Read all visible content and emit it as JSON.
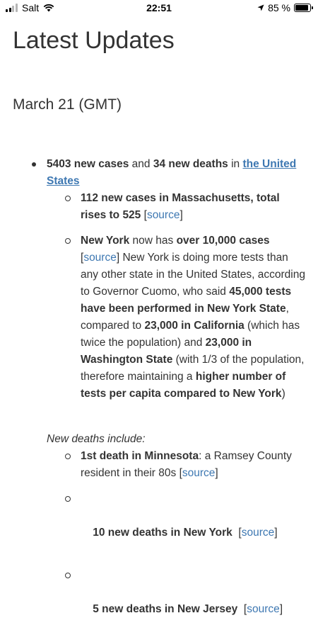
{
  "status_bar": {
    "carrier": "Salt",
    "time": "22:51",
    "battery": "85 %"
  },
  "page": {
    "title": "Latest Updates",
    "date": "March 21 (GMT)"
  },
  "main_item": {
    "cases": "5403 new cases",
    "and": " and ",
    "deaths": "34 new deaths",
    "in": " in ",
    "country_link": "the United States"
  },
  "sub_items": {
    "mass": {
      "bold": "112 new cases in Massachusetts, total rises to 525",
      "open": " [",
      "source": "source",
      "close": "]"
    },
    "ny": {
      "t1": "New York",
      "t2": " now has ",
      "t3": "over 10,000 cases",
      "t4": "[",
      "source": "source",
      "t5": "] New York is doing more tests than any other state in the United States, according to Governor Cuomo, who said ",
      "t6": "45,000 tests have been performed in New York State",
      "t7": ", compared to ",
      "t8": "23,000 in California",
      "t9": " (which has twice the population) and ",
      "t10": "23,000 in Washington State",
      "t11": " (with 1/3 of the population, therefore maintaining a ",
      "t12": "higher number of tests per capita compared to New York",
      "t13": ")"
    }
  },
  "new_deaths": {
    "label": "New deaths include:",
    "items": [
      {
        "bold": "1st death in Minnesota",
        "text": ": a Ramsey County resident in their 80s [",
        "source": "source",
        "close": "]"
      },
      {
        "bold": "10 new deaths in New York",
        "text": "  [",
        "source": "source",
        "close": "]"
      },
      {
        "bold": "5 new deaths in New Jersey",
        "text": "  [",
        "source": "source",
        "close": "]"
      }
    ]
  }
}
